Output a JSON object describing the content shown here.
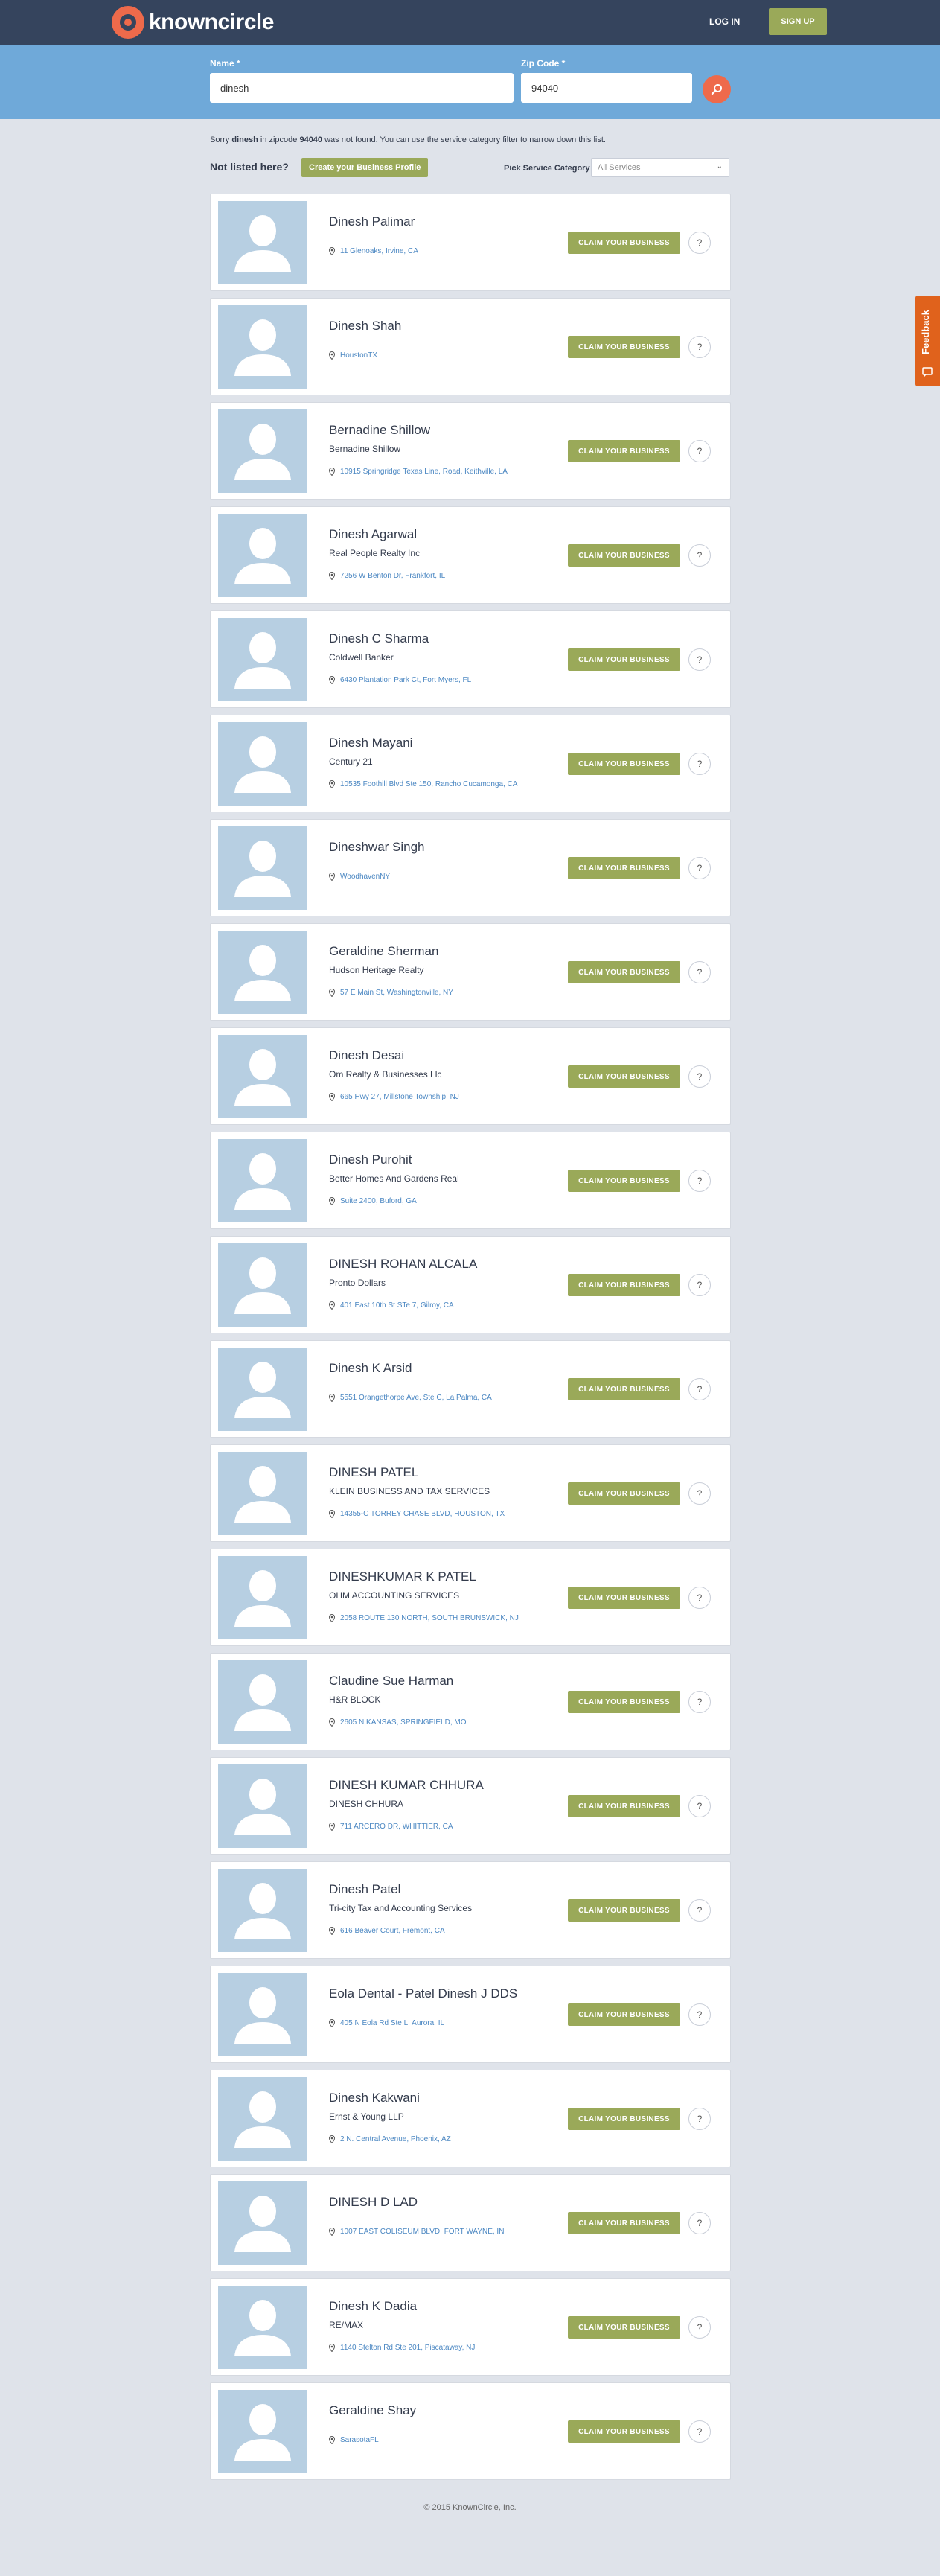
{
  "header": {
    "logo_text": "knowncircle",
    "login_label": "LOG IN",
    "signup_label": "SIGN UP",
    "colors": {
      "bar": "#35445d",
      "accent": "#ee6a4b",
      "green": "#9aa959"
    }
  },
  "search": {
    "name_label": "Name *",
    "name_value": "dinesh",
    "zip_label": "Zip Code *",
    "zip_value": "94040",
    "search_icon": "search-icon"
  },
  "notice": {
    "prefix": "Sorry ",
    "query": "dinesh",
    "middle": " in zipcode ",
    "zip": "94040",
    "suffix": " was not found. You can use the service category filter to narrow down this list."
  },
  "toolbar": {
    "not_listed": "Not listed here?",
    "create_label": "Create your Business Profile",
    "pick_label": "Pick Service Category",
    "category_value": "All Services"
  },
  "card_actions": {
    "claim_label": "CLAIM YOUR BUSINESS",
    "help_label": "?"
  },
  "results": [
    {
      "name": "Dinesh Palimar",
      "company": "",
      "address": "11 Glenoaks, Irvine, CA"
    },
    {
      "name": "Dinesh Shah",
      "company": "",
      "address": "HoustonTX"
    },
    {
      "name": "Bernadine Shillow",
      "company": "Bernadine Shillow",
      "address": "10915 Springridge Texas Line, Road, Keithville, LA"
    },
    {
      "name": "Dinesh Agarwal",
      "company": "Real People Realty Inc",
      "address": "7256 W Benton Dr, Frankfort, IL"
    },
    {
      "name": "Dinesh C Sharma",
      "company": "Coldwell Banker",
      "address": "6430 Plantation Park Ct, Fort Myers, FL"
    },
    {
      "name": "Dinesh Mayani",
      "company": "Century 21",
      "address": "10535 Foothill Blvd Ste 150, Rancho Cucamonga, CA"
    },
    {
      "name": "Dineshwar Singh",
      "company": "",
      "address": "WoodhavenNY"
    },
    {
      "name": "Geraldine Sherman",
      "company": "Hudson Heritage Realty",
      "address": "57 E Main St, Washingtonville, NY"
    },
    {
      "name": "Dinesh Desai",
      "company": "Om Realty & Businesses Llc",
      "address": "665 Hwy 27, Millstone Township, NJ"
    },
    {
      "name": "Dinesh Purohit",
      "company": "Better Homes And Gardens Real",
      "address": "Suite 2400, Buford, GA"
    },
    {
      "name": "DINESH ROHAN ALCALA",
      "company": "Pronto Dollars",
      "address": "401 East 10th St STe 7, Gilroy, CA"
    },
    {
      "name": "Dinesh K Arsid",
      "company": "",
      "address": "5551 Orangethorpe Ave, Ste C, La Palma, CA"
    },
    {
      "name": "DINESH PATEL",
      "company": "KLEIN BUSINESS AND TAX SERVICES",
      "address": "14355-C TORREY CHASE BLVD, HOUSTON, TX"
    },
    {
      "name": "DINESHKUMAR K PATEL",
      "company": "OHM ACCOUNTING SERVICES",
      "address": "2058 ROUTE 130 NORTH, SOUTH BRUNSWICK, NJ"
    },
    {
      "name": "Claudine Sue Harman",
      "company": "H&R BLOCK",
      "address": "2605 N KANSAS, SPRINGFIELD, MO"
    },
    {
      "name": "DINESH KUMAR CHHURA",
      "company": "DINESH CHHURA",
      "address": "711 ARCERO DR, WHITTIER, CA"
    },
    {
      "name": "Dinesh Patel",
      "company": "Tri-city Tax and Accounting Services",
      "address": "616 Beaver Court, Fremont, CA"
    },
    {
      "name": "Eola Dental - Patel Dinesh J DDS",
      "company": "",
      "address": "405 N Eola Rd Ste L, Aurora, IL"
    },
    {
      "name": "Dinesh Kakwani",
      "company": "Ernst & Young LLP",
      "address": "2 N. Central Avenue, Phoenix, AZ"
    },
    {
      "name": "DINESH D LAD",
      "company": "",
      "address": "1007 EAST COLISEUM BLVD, FORT WAYNE, IN"
    },
    {
      "name": "Dinesh K Dadia",
      "company": "RE/MAX",
      "address": "1140 Stelton Rd Ste 201, Piscataway, NJ"
    },
    {
      "name": "Geraldine Shay",
      "company": "",
      "address": "SarasotaFL"
    }
  ],
  "footer": {
    "copyright": "© 2015 KnownCircle, Inc."
  },
  "feedback": {
    "label": "Feedback"
  }
}
